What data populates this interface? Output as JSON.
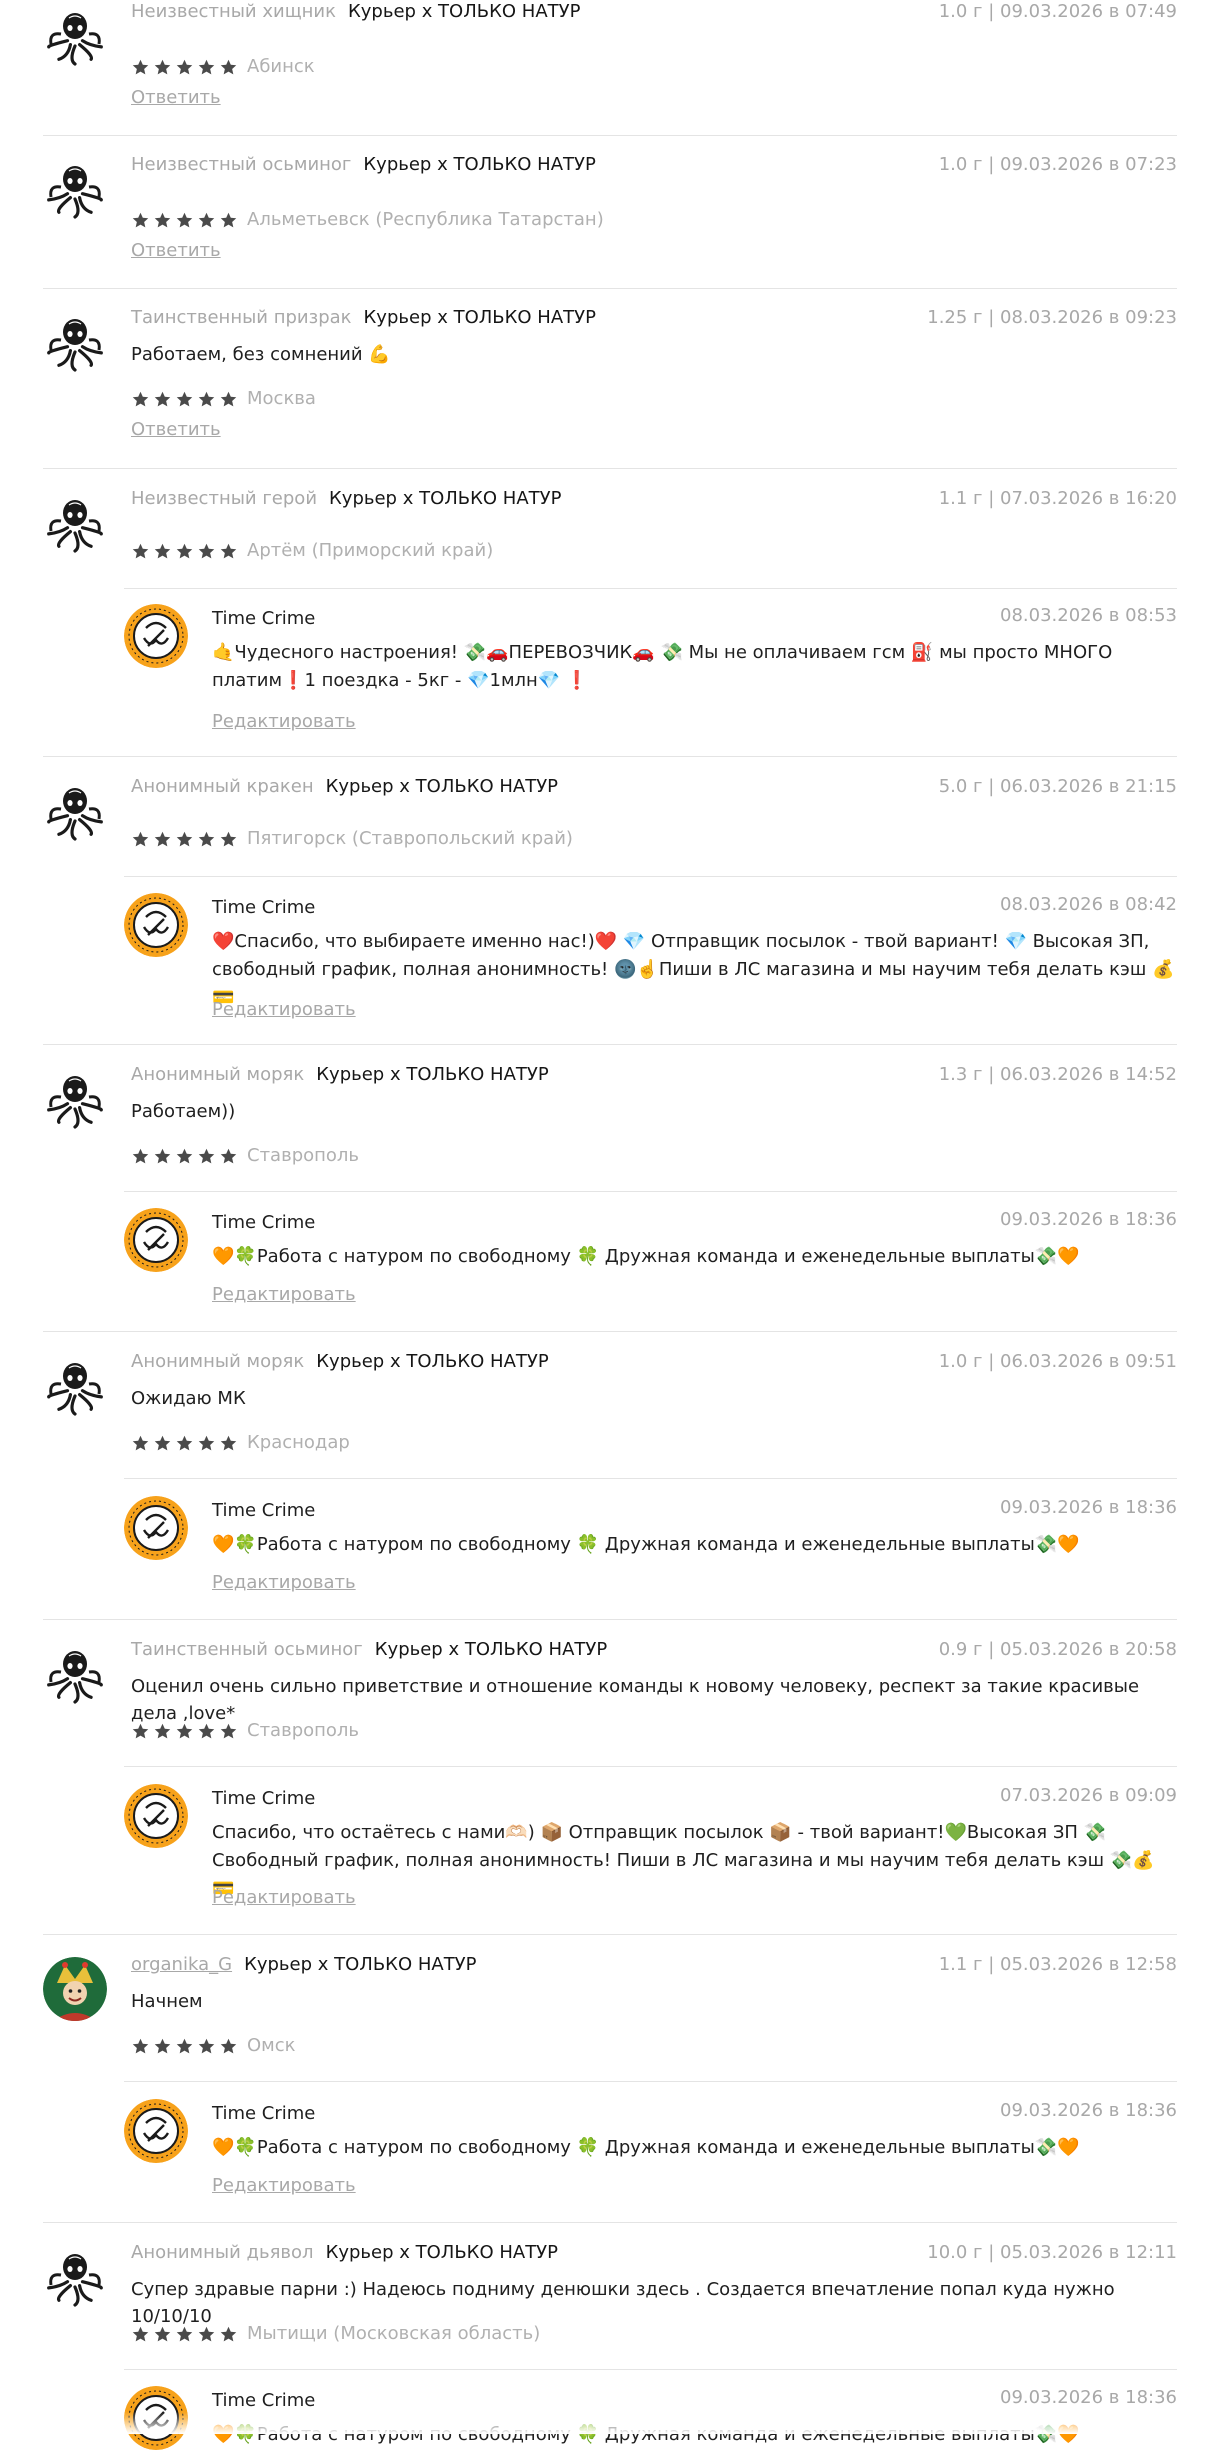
{
  "reply_label": "Ответить",
  "edit_label": "Редактировать",
  "colors": {
    "stars": "#4a4a4a",
    "muted": "#a8a8a8",
    "divider": "#e4e4e4",
    "shop_logo": "#f7a21b"
  },
  "reviews": [
    {
      "author": "Неизвестный хищник",
      "product": "Курьер х ТОЛЬКО НАТУР",
      "meta": "1.0 г | 09.03.2026 в 07:49",
      "text": "",
      "stars": 5,
      "city": "Абинск",
      "has_reply_link": true,
      "shop_reply": null
    },
    {
      "author": "Неизвестный осьминог",
      "product": "Курьер х ТОЛЬКО НАТУР",
      "meta": "1.0 г | 09.03.2026 в 07:23",
      "text": "",
      "stars": 5,
      "city": "Альметьевск (Республика Татарстан)",
      "has_reply_link": true,
      "shop_reply": null
    },
    {
      "author": "Таинственный призрак",
      "product": "Курьер х ТОЛЬКО НАТУР",
      "meta": "1.25 г | 08.03.2026 в 09:23",
      "text": "Работаем, без сомнений 💪",
      "stars": 5,
      "city": "Москва",
      "has_reply_link": true,
      "shop_reply": null
    },
    {
      "author": "Неизвестный герой",
      "product": "Курьер х ТОЛЬКО НАТУР",
      "meta": "1.1 г | 07.03.2026 в 16:20",
      "text": "",
      "stars": 5,
      "city": "Артём (Приморский край)",
      "has_reply_link": false,
      "shop_reply": {
        "name": "Time Crime",
        "date": "08.03.2026 в 08:53",
        "text": "🤙Чудесного настроения! 💸🚗ПЕРЕВОЗЧИК🚗 💸 Мы не оплачиваем гсм ⛽ мы просто МНОГО платим❗1 поездка - 5кг - 💎1млн💎 ❗"
      }
    },
    {
      "author": "Анонимный кракен",
      "product": "Курьер х ТОЛЬКО НАТУР",
      "meta": "5.0 г | 06.03.2026 в 21:15",
      "text": "",
      "stars": 5,
      "city": "Пятигорск (Ставропольский край)",
      "has_reply_link": false,
      "shop_reply": {
        "name": "Time Crime",
        "date": "08.03.2026 в 08:42",
        "text": "❤️Спасибо, что выбираете именно нас!)❤️ 💎 Отправщик посылок - твой вариант! 💎 Высокая ЗП, свободный график, полная анонимность! 🌚☝️Пиши в ЛС магазина и мы научим тебя делать кэш 💰💳"
      }
    },
    {
      "author": "Анонимный моряк",
      "product": "Курьер х ТОЛЬКО НАТУР",
      "meta": "1.3 г | 06.03.2026 в 14:52",
      "text": "Работаем))",
      "stars": 5,
      "city": "Ставрополь",
      "has_reply_link": false,
      "shop_reply": {
        "name": "Time Crime",
        "date": "09.03.2026 в 18:36",
        "text": "🧡🍀Работа с натуром по свободному 🍀 Дружная команда и еженедельные выплаты💸🧡"
      }
    },
    {
      "author": "Анонимный моряк",
      "product": "Курьер х ТОЛЬКО НАТУР",
      "meta": "1.0 г | 06.03.2026 в 09:51",
      "text": "Ожидаю МК",
      "stars": 5,
      "city": "Краснодар",
      "has_reply_link": false,
      "shop_reply": {
        "name": "Time Crime",
        "date": "09.03.2026 в 18:36",
        "text": "🧡🍀Работа с натуром по свободному 🍀 Дружная команда и еженедельные выплаты💸🧡"
      }
    },
    {
      "author": "Таинственный осьминог",
      "product": "Курьер х ТОЛЬКО НАТУР",
      "meta": "0.9 г | 05.03.2026 в 20:58",
      "text": "Оценил очень сильно приветствие и отношение команды к новому человеку, респект за такие красивые дела ,love*",
      "stars": 5,
      "city": "Ставрополь",
      "has_reply_link": false,
      "shop_reply": {
        "name": "Time Crime",
        "date": "07.03.2026 в 09:09",
        "text": "Спасибо, что остаётесь с нами🫶🏻) 📦 Отправщик посылок 📦 - твой вариант!💚Высокая ЗП 💸 Свободный график, полная анонимность! Пиши в ЛС магазина и мы научим тебя делать кэш 💸💰💳"
      }
    },
    {
      "author": "organika_G",
      "author_link": true,
      "product": "Курьер х ТОЛЬКО НАТУР",
      "meta": "1.1 г | 05.03.2026 в 12:58",
      "text": "Начнем",
      "stars": 5,
      "city": "Омск",
      "has_reply_link": false,
      "shop_reply": {
        "name": "Time Crime",
        "date": "09.03.2026 в 18:36",
        "text": "🧡🍀Работа с натуром по свободному 🍀 Дружная команда и еженедельные выплаты💸🧡"
      }
    },
    {
      "author": "Анонимный дьявол",
      "product": "Курьер х ТОЛЬКО НАТУР",
      "meta": "10.0 г | 05.03.2026 в 12:11",
      "text": "Супер здравые парни :) Надеюсь подниму денюшки здесь . Создается впечатление попал куда нужно 10/10/10",
      "stars": 5,
      "city": "Мытищи (Московская область)",
      "has_reply_link": false,
      "shop_reply": {
        "name": "Time Crime",
        "date": "09.03.2026 в 18:36",
        "text": "🧡🍀Работа с натуром по свободному 🍀 Дружная команда и еженедельные выплаты💸🧡"
      }
    }
  ]
}
